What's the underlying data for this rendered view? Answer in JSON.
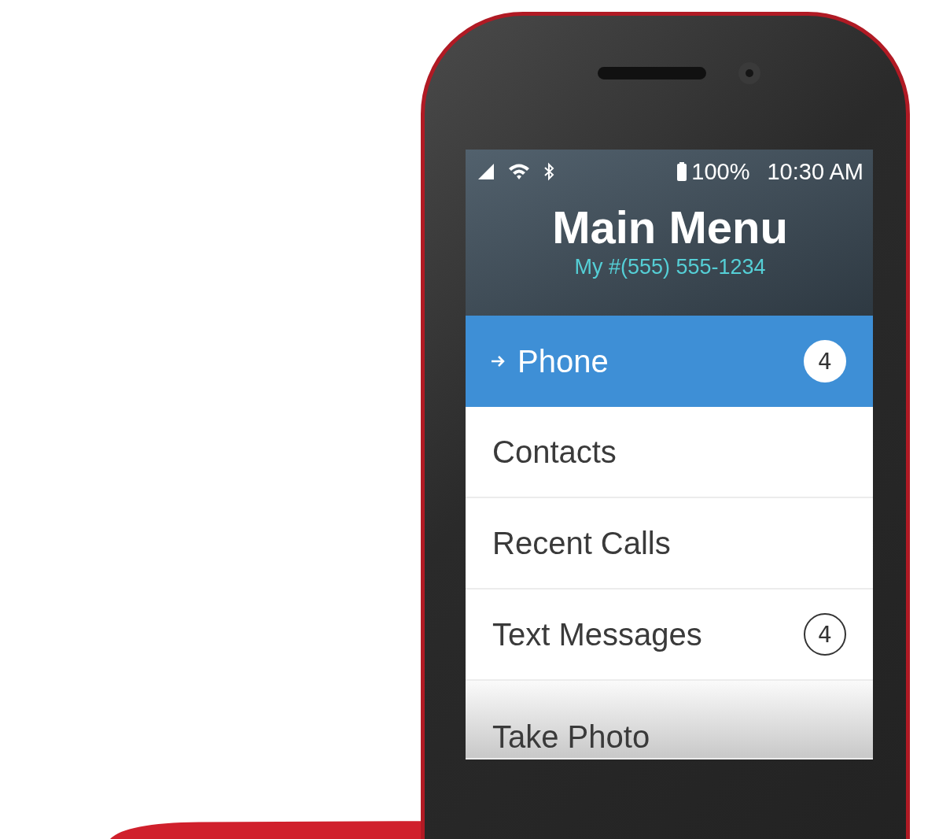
{
  "status_bar": {
    "battery": "100%",
    "time": "10:30 AM"
  },
  "header": {
    "title": "Main Menu",
    "subtitle": "My #(555) 555-1234"
  },
  "menu": [
    {
      "label": "Phone",
      "selected": true,
      "badge": "4"
    },
    {
      "label": "Contacts",
      "selected": false
    },
    {
      "label": "Recent Calls",
      "selected": false
    },
    {
      "label": "Text Messages",
      "selected": false,
      "badge": "4"
    },
    {
      "label": "Take Photo",
      "selected": false
    }
  ]
}
